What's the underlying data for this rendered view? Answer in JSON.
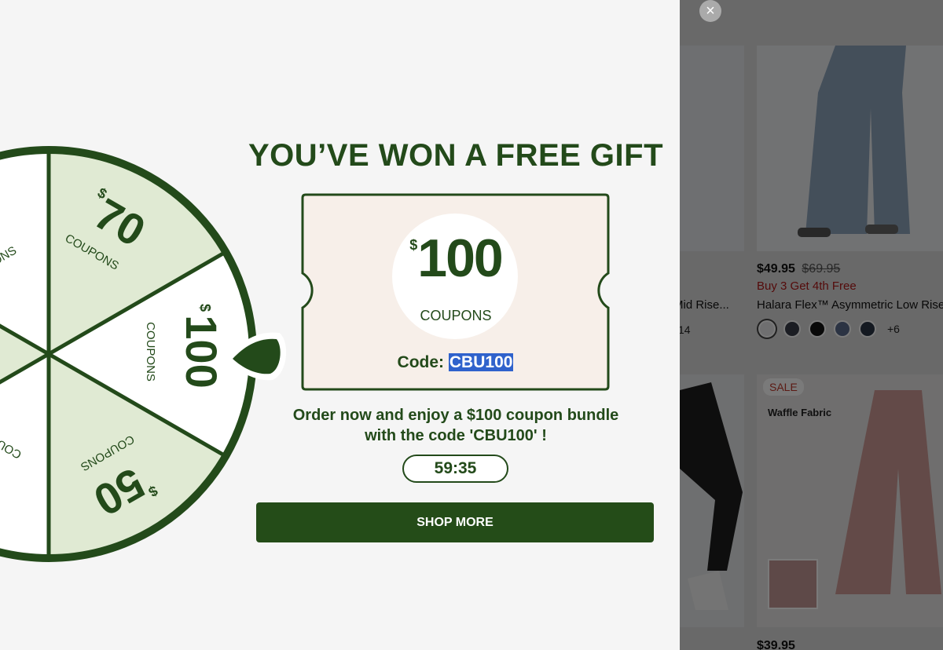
{
  "modal": {
    "title": "YOU’VE WON A FREE GIFT",
    "coupon": {
      "currency": "$",
      "amount": "100",
      "label": "COUPONS",
      "code_label": "Code:",
      "code": "CBU100"
    },
    "message": "Order now and enjoy a $100 coupon bundle with the code 'CBU100' !",
    "timer": "59:35",
    "shop_button": "SHOP MORE",
    "wheel": {
      "segments": [
        {
          "currency": "$",
          "amount": "70",
          "label": "COUPONS"
        },
        {
          "currency": "$",
          "amount": "100",
          "label": "COUPONS"
        },
        {
          "currency": "$",
          "amount": "50",
          "label": "COUPONS"
        },
        {
          "label_partial_upper": "ONS",
          "label_partial_lower": "COU"
        }
      ]
    },
    "colors": {
      "brand_green": "#234a1a",
      "segment_light": "#e0ead3",
      "ticket_bg": "#f7efe9"
    }
  },
  "close_icon": "close-icon",
  "store": {
    "product_1": {
      "name": "Mid Rise...",
      "count": "14"
    },
    "product_2": {
      "price": "$49.95",
      "old_price": "$69.95",
      "promo": "Buy 3 Get 4th Free",
      "name": "Halara Flex™ Asymmetric Low Rise...",
      "more_colors": "+6",
      "swatches": [
        "#e8e8ea",
        "#3a3d4a",
        "#141414",
        "#5a6b8c",
        "#2a3646"
      ]
    },
    "product_4": {
      "badge": "SALE",
      "feature": "Waffle Fabric",
      "price": "$39.95"
    }
  }
}
